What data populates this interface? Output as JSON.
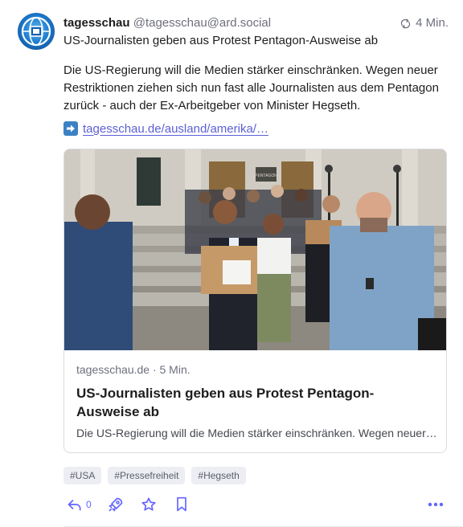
{
  "post": {
    "display_name": "tagesschau",
    "handle": "@tagesschau@ard.social",
    "time": "4 Min.",
    "title": "US-Journalisten geben aus Protest Pentagon-Ausweise ab",
    "body": "Die US-Regierung will die Medien stärker einschränken. Wegen neuer Restriktionen ziehen sich nun fast alle Journalisten aus dem Pentagon zurück - auch der Ex-Arbeitgeber von Minister Hegseth.",
    "link_text": "tagesschau.de/ausland/amerika/…",
    "icons": {
      "avatar": "tagesschau-logo-avatar",
      "time": "refresh-icon",
      "link": "right-arrow-emoji-icon"
    }
  },
  "card": {
    "source": "tagesschau.de · 5 Min.",
    "title": "US-Journalisten geben aus Protest Pentagon-Ausweise ab",
    "description": "Die US-Regierung will die Medien stärker einschränken. Wegen neuer Restriktionen ziehen sich nun fast alle Journalisten aus dem Pentagon zurück - auch der Ex-Arbeitgeber von Minister Hegseth.",
    "image_sign_text": "PENTAGON"
  },
  "tags": [
    "#USA",
    "#Pressefreiheit",
    "#Hegseth"
  ],
  "actions": {
    "reply_count": "0",
    "icons": [
      "reply-icon",
      "boost-rocket-icon",
      "star-icon",
      "bookmark-icon",
      "more-icon"
    ]
  },
  "colors": {
    "accent": "#6364ff",
    "link": "#5b5fd6",
    "muted": "#6d6f7d",
    "tag_bg": "#eceef3"
  }
}
